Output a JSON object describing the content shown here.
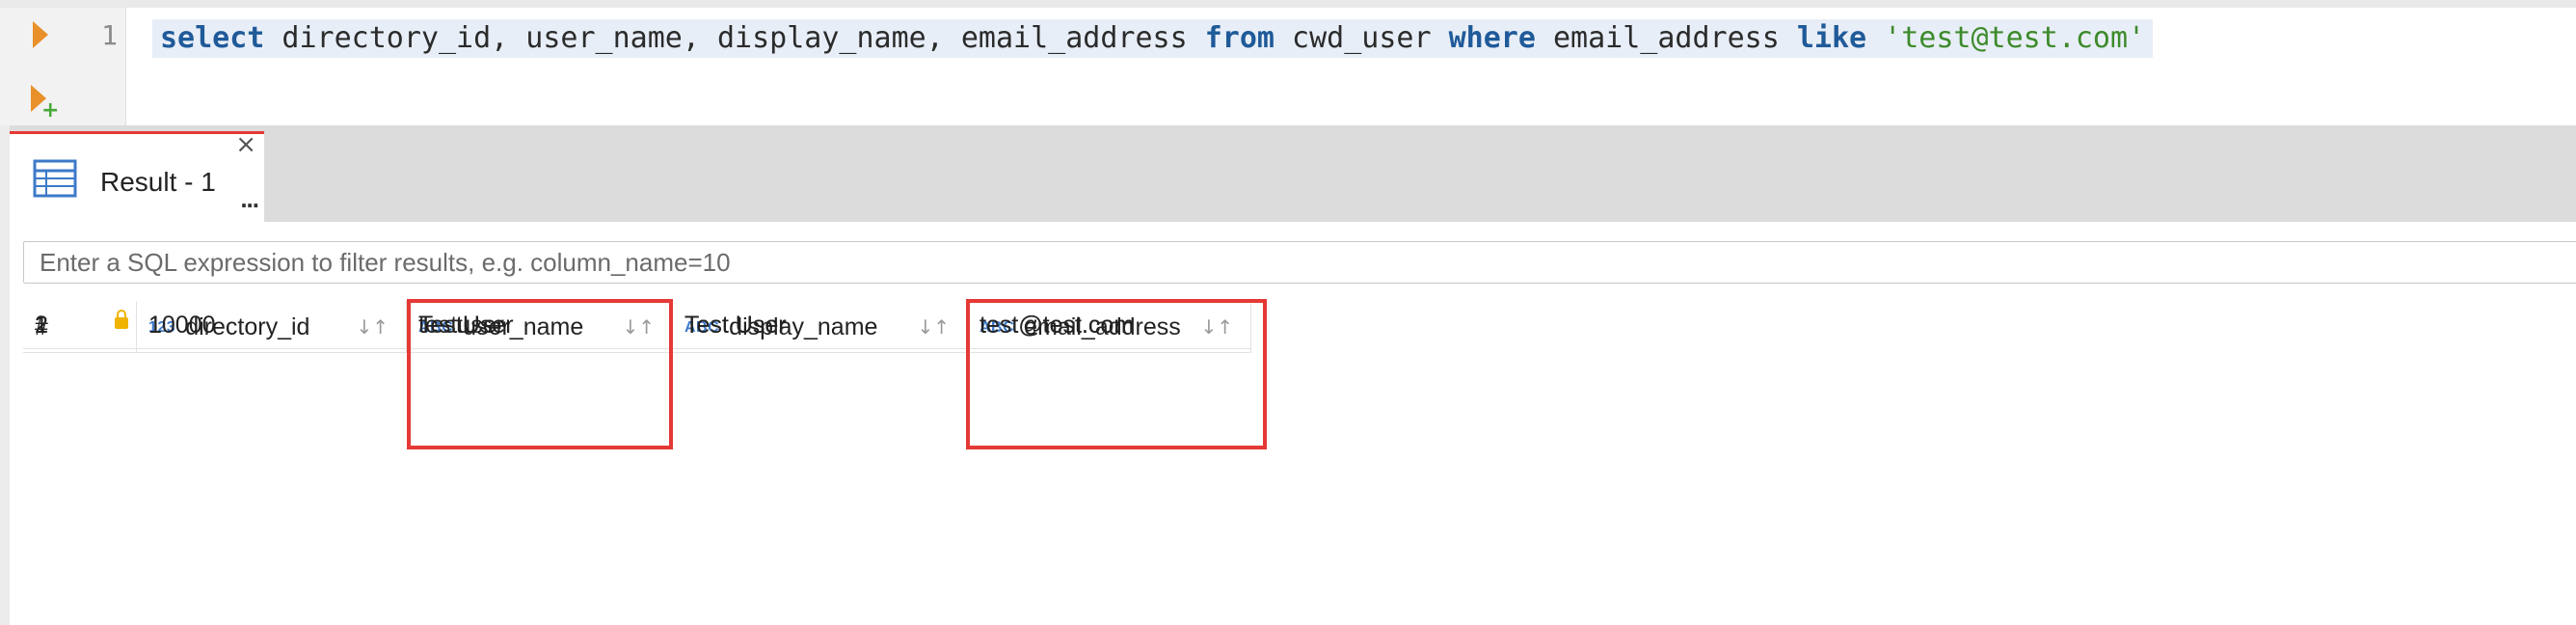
{
  "editor": {
    "line_number": "1",
    "tokens": {
      "k_select": "select",
      "t1": " directory_id, user_name, display_name, email_address ",
      "k_from": "from",
      "t2": " cwd_user ",
      "k_where": "where",
      "t3": " email_address ",
      "k_like": "like",
      "t4": " ",
      "s_value": "'test@test.com'"
    },
    "run_icon": "run-statement-icon",
    "run_script_icon": "run-script-icon"
  },
  "results_tab": {
    "label": "Result - 1",
    "close": "×",
    "more": "...",
    "icon": "grid-table-icon"
  },
  "filter": {
    "placeholder": "Enter a SQL expression to filter results, e.g. column_name=10"
  },
  "grid": {
    "row_number_header": "#",
    "columns": [
      {
        "type": "123",
        "name": "directory_id",
        "highlighted": false
      },
      {
        "type": "ABC",
        "name": "user_name",
        "highlighted": true
      },
      {
        "type": "ABC",
        "name": "display_name",
        "highlighted": false
      },
      {
        "type": "ABC",
        "name": "email_address",
        "highlighted": true
      }
    ],
    "rows": [
      {
        "n": "1",
        "cells": [
          "10000",
          "testuser",
          "Test User",
          "test@test.com"
        ]
      },
      {
        "n": "2",
        "cells": [
          "1",
          "TestUser",
          "Test User",
          "test@test.com"
        ]
      }
    ],
    "sort_glyph": "↓↑",
    "highlight_color": "#e53935"
  },
  "colors": {
    "accent_orange": "#e8902a",
    "keyword_blue": "#1f5a99",
    "string_green": "#3c8a2a",
    "tab_active_border": "#e53935"
  }
}
